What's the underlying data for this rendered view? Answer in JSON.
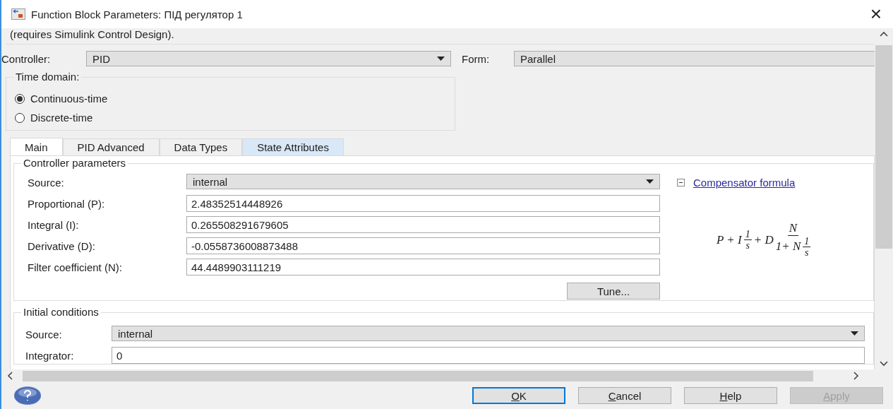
{
  "window": {
    "title": "Function Block Parameters: ПІД регулятор 1",
    "close": "×"
  },
  "description": "(requires Simulink Control Design).",
  "controller": {
    "label": "Controller:",
    "value": "PID"
  },
  "form": {
    "label": "Form:",
    "value": "Parallel"
  },
  "time_domain": {
    "title": "Time domain:",
    "options": [
      {
        "label": "Continuous-time",
        "selected": true
      },
      {
        "label": "Discrete-time",
        "selected": false
      }
    ]
  },
  "tabs": [
    {
      "label": "Main",
      "selected": true,
      "hover": false
    },
    {
      "label": "PID Advanced",
      "selected": false,
      "hover": false
    },
    {
      "label": "Data Types",
      "selected": false,
      "hover": false
    },
    {
      "label": "State Attributes",
      "selected": false,
      "hover": true
    }
  ],
  "controller_parameters": {
    "title": "Controller parameters",
    "source": {
      "label": "Source:",
      "value": "internal"
    },
    "fields": [
      {
        "label": "Proportional (P):",
        "value": "2.48352514448926"
      },
      {
        "label": "Integral (I):",
        "value": "0.265508291679605"
      },
      {
        "label": "Derivative (D):",
        "value": "-0.0558736008873488"
      },
      {
        "label": "Filter coefficient (N):",
        "value": "44.4489903111219"
      }
    ],
    "tune_button": "Tune...",
    "compensator_link": "Compensator formula",
    "compensator_expanded": true,
    "formula": {
      "lead": "P + I",
      "f1_num": "1",
      "f1_den": "s",
      "mid": "+ D",
      "f2_num": "N",
      "f2_den": "1+ N",
      "f3_num": "1",
      "f3_den": "s"
    }
  },
  "initial_conditions": {
    "title": "Initial conditions",
    "source": {
      "label": "Source:",
      "value": "internal"
    },
    "integrator": {
      "label": "Integrator:",
      "value": "0"
    }
  },
  "buttons": [
    {
      "label": "OK",
      "disabled": false,
      "default": true
    },
    {
      "label": "Cancel",
      "disabled": false,
      "default": false
    },
    {
      "label": "Help",
      "disabled": false,
      "default": false
    },
    {
      "label": "Apply",
      "disabled": true,
      "default": false
    }
  ]
}
